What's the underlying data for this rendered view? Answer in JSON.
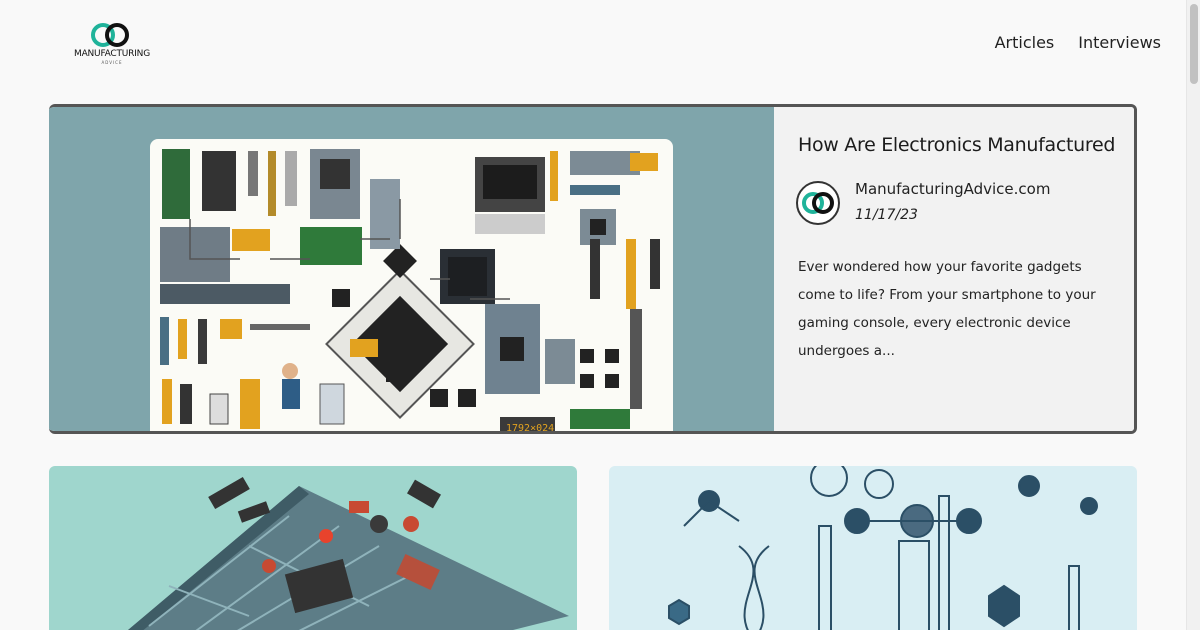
{
  "header": {
    "logo_text": "MANUFACTURING",
    "logo_sub": "ADVICE",
    "nav": [
      "Articles",
      "Interviews"
    ]
  },
  "featured": {
    "title": "How Are Electronics Manufactured",
    "author": "ManufacturingAdvice.com",
    "date": "11/17/23",
    "excerpt": "Ever wondered how your favorite gadgets come to life? From your smartphone to your gaming console, every electronic device undergoes a...",
    "image_caption": "1792×024"
  },
  "colors": {
    "accent": "#1fb39a",
    "background": "#f9f9f9",
    "feature_image_bg": "#7fa5ab"
  }
}
